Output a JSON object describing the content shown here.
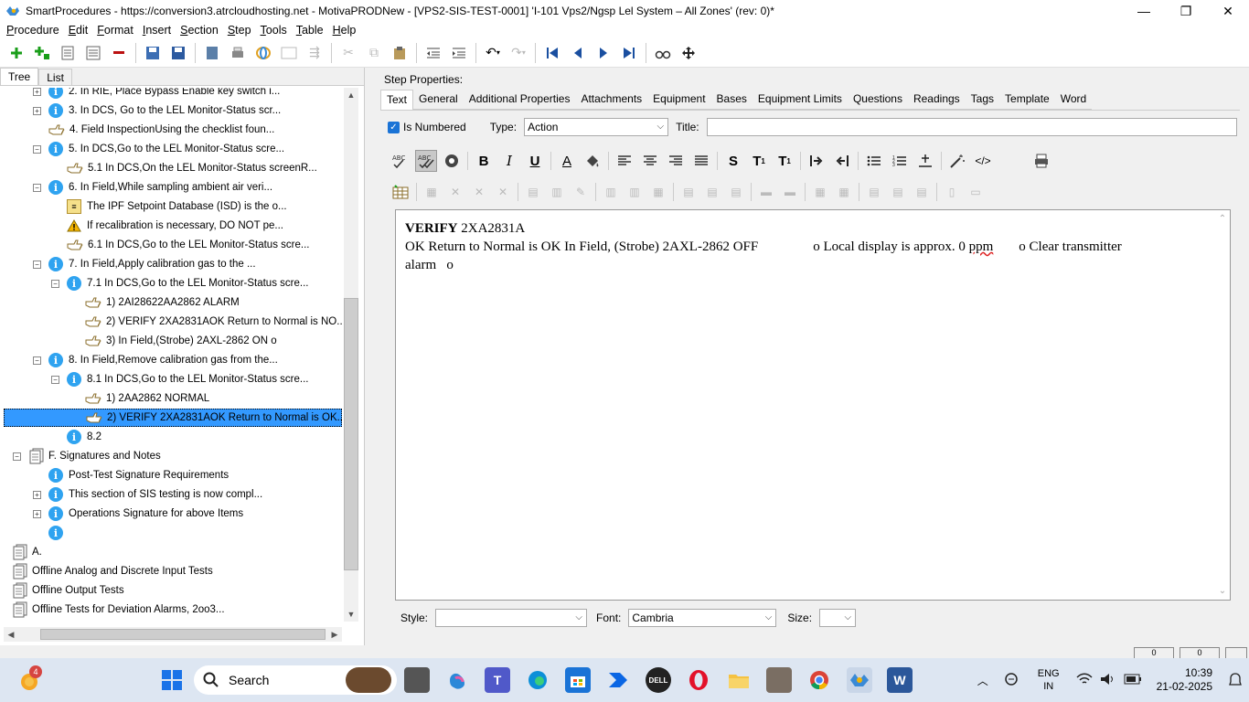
{
  "window": {
    "title": "SmartProcedures - https://conversion3.atrcloudhosting.net - MotivaPRODNew - [VPS2-SIS-TEST-0001] 'I-101 Vps2/Ngsp Lel System – All Zones' (rev: 0)*",
    "minimize": "—",
    "maximize": "❐",
    "close": "✕"
  },
  "menu": [
    {
      "hot": "P",
      "rest": "rocedure"
    },
    {
      "hot": "E",
      "rest": "dit"
    },
    {
      "hot": "F",
      "rest": "ormat"
    },
    {
      "hot": "I",
      "rest": "nsert"
    },
    {
      "hot": "S",
      "rest": "ection"
    },
    {
      "hot": "S",
      "rest": "tep"
    },
    {
      "hot": "T",
      "rest": "ools"
    },
    {
      "hot": "T",
      "rest": "able"
    },
    {
      "hot": "H",
      "rest": "elp"
    }
  ],
  "left_tabs": {
    "tree": "Tree",
    "list": "List"
  },
  "tree": [
    {
      "indent": 0,
      "exp": "+",
      "icon": "info",
      "label": "2. In RIE, Place Bypass Enable key switch i..."
    },
    {
      "indent": 0,
      "exp": "+",
      "icon": "info",
      "label": "3. In DCS, Go to the LEL Monitor-Status scr..."
    },
    {
      "indent": 0,
      "exp": "",
      "icon": "hand",
      "label": "4. Field InspectionUsing the checklist foun..."
    },
    {
      "indent": 0,
      "exp": "−",
      "icon": "info",
      "label": "5. In DCS,Go to the LEL Monitor-Status scre..."
    },
    {
      "indent": 1,
      "exp": "",
      "icon": "hand",
      "label": "5.1 In DCS,On the LEL Monitor-Status screenR..."
    },
    {
      "indent": 0,
      "exp": "−",
      "icon": "info",
      "label": "6. In Field,While sampling ambient air veri..."
    },
    {
      "indent": 1,
      "exp": "",
      "icon": "db",
      "label": "The IPF Setpoint Database (ISD) is the o..."
    },
    {
      "indent": 1,
      "exp": "",
      "icon": "warn",
      "label": "If recalibration is necessary, DO NOT pe..."
    },
    {
      "indent": 1,
      "exp": "",
      "icon": "hand",
      "label": "6.1 In DCS,Go to the LEL Monitor-Status scre..."
    },
    {
      "indent": 0,
      "exp": "−",
      "icon": "info",
      "label": "7. In Field,Apply calibration gas to the ..."
    },
    {
      "indent": 1,
      "exp": "−",
      "icon": "info",
      "label": "7.1 In DCS,Go to the LEL Monitor-Status scre..."
    },
    {
      "indent": 2,
      "exp": "",
      "icon": "hand",
      "label": "1) 2AI28622AA2862 ALARM"
    },
    {
      "indent": 2,
      "exp": "",
      "icon": "hand",
      "label": "2) VERIFY 2XA2831AOK Return to Normal is NO..."
    },
    {
      "indent": 2,
      "exp": "",
      "icon": "hand",
      "label": "3) In Field,(Strobe) 2AXL-2862 ON o"
    },
    {
      "indent": 0,
      "exp": "−",
      "icon": "info",
      "label": "8. In Field,Remove calibration gas from the..."
    },
    {
      "indent": 1,
      "exp": "−",
      "icon": "info",
      "label": "8.1 In DCS,Go to the LEL Monitor-Status scre..."
    },
    {
      "indent": 2,
      "exp": "",
      "icon": "hand",
      "label": "1) 2AA2862 NORMAL"
    },
    {
      "indent": 2,
      "exp": "",
      "icon": "hand",
      "label": "2) VERIFY 2XA2831AOK Return to Normal is OK...",
      "selected": true
    },
    {
      "indent": 1,
      "exp": "",
      "icon": "info",
      "label": "8.2"
    },
    {
      "indent": -1,
      "exp": "−",
      "icon": "doc",
      "label": "F. Signatures and Notes"
    },
    {
      "indent": 0,
      "exp": "",
      "icon": "info",
      "label": "Post-Test Signature Requirements"
    },
    {
      "indent": 0,
      "exp": "+",
      "icon": "info",
      "label": "This section of SIS testing is now compl..."
    },
    {
      "indent": 0,
      "exp": "+",
      "icon": "info",
      "label": "Operations Signature for above Items"
    },
    {
      "indent": 0,
      "exp": "",
      "icon": "info",
      "label": ""
    },
    {
      "indent": -2,
      "exp": "",
      "icon": "doc",
      "label": "A."
    },
    {
      "indent": -2,
      "exp": "",
      "icon": "doc",
      "label": "Offline Analog and Discrete Input Tests"
    },
    {
      "indent": -2,
      "exp": "",
      "icon": "doc",
      "label": "Offline Output Tests"
    },
    {
      "indent": -2,
      "exp": "",
      "icon": "doc",
      "label": "Offline Tests for Deviation Alarms, 2oo3..."
    }
  ],
  "step_properties": {
    "label": "Step Properties:",
    "tabs": [
      "Text",
      "General",
      "Additional Properties",
      "Attachments",
      "Equipment",
      "Bases",
      "Equipment Limits",
      "Questions",
      "Readings",
      "Tags",
      "Template",
      "Word"
    ],
    "is_numbered_label": "Is Numbered",
    "type_label": "Type:",
    "type_value": "Action",
    "title_label": "Title:",
    "title_value": ""
  },
  "editor": {
    "bold_word": "VERIFY",
    "line1_rest": " 2XA2831A",
    "line2": "OK Return to Normal is OK In Field, (Strobe) 2AXL-2862 OFF",
    "line2b": "o Local display is approx. 0",
    "ppm": "ppm",
    "line2c": "o Clear transmitter",
    "line3": "alarm   o"
  },
  "bottom": {
    "style_label": "Style:",
    "style_value": "",
    "font_label": "Font:",
    "font_value": "Cambria",
    "size_label": "Size:",
    "size_value": ""
  },
  "statusbar": {
    "box1": "0",
    "box2": "0"
  },
  "taskbar": {
    "weather_badge": "4",
    "search": "Search",
    "lang1": "ENG",
    "lang2": "IN",
    "time": "10:39",
    "date": "21-02-2025"
  }
}
